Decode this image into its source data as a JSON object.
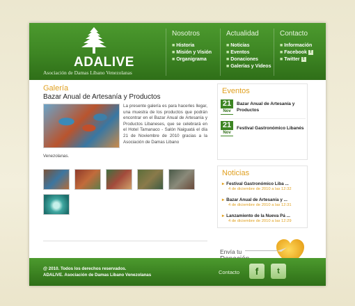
{
  "brand": {
    "name": "ADALIVE",
    "subtitle": "Asociación de Damas Líbano Venezolanas"
  },
  "nav": [
    {
      "heading": "Nosotros",
      "items": [
        "Historia",
        "Misión y Visión",
        "Organigrama"
      ]
    },
    {
      "heading": "Actualidad",
      "items": [
        "Noticias",
        "Eventos",
        "Donaciones",
        "Galerías y Videos"
      ]
    },
    {
      "heading": "Contacto",
      "items": [
        "Información",
        "Facebook",
        "Twitter"
      ]
    }
  ],
  "gallery": {
    "section_title": "Galería",
    "article_title": "Bazar Anual de Artesanía y Productos",
    "text_main": "La presente galería es para hacerles llegar, una muestra de los productos que podrán encontrar en el Bazar Anual de Artesanía y Productos Libaneses, que se celebrará en el Hotel Tamanaco - Salón Naiguatá el día 21 de Noviembre de 2010 gracias a la Asociación de Damas Libano",
    "text_tail": "Venezolanas."
  },
  "eventos": {
    "title": "Eventos",
    "items": [
      {
        "day": "21",
        "month": "Nov",
        "title": "Bazar Anual de Artesanía y Productos"
      },
      {
        "day": "21",
        "month": "Nov",
        "title": "Festival Gastronómico Libanés"
      }
    ]
  },
  "noticias": {
    "title": "Noticias",
    "items": [
      {
        "title": "Festival Gastronómico Liba ...",
        "date": "4 de diciembre de 2010 a las 12:32"
      },
      {
        "title": "Bazar Anual de Artesanía y ...",
        "date": "4 de diciembre de 2010 a las 12:31"
      },
      {
        "title": "Lanzamiento de la Nueva Pá ...",
        "date": "4 de diciembre de 2010 a las 12:29"
      }
    ]
  },
  "donate": {
    "line1": "Envía tu",
    "line2": "Donación"
  },
  "footer": {
    "copy1": "@ 2010. Todos los derechos reservados.",
    "copy2": "ADALIVE. Asociación de Damas Libano Venezolanas",
    "contact_label": "Contacto"
  },
  "colors": {
    "green": "#3d8523",
    "accent": "#e0a020"
  },
  "icons": [
    "cedar-logo-icon",
    "facebook-icon",
    "twitter-icon",
    "heart-icon",
    "paper-plane-icon"
  ]
}
